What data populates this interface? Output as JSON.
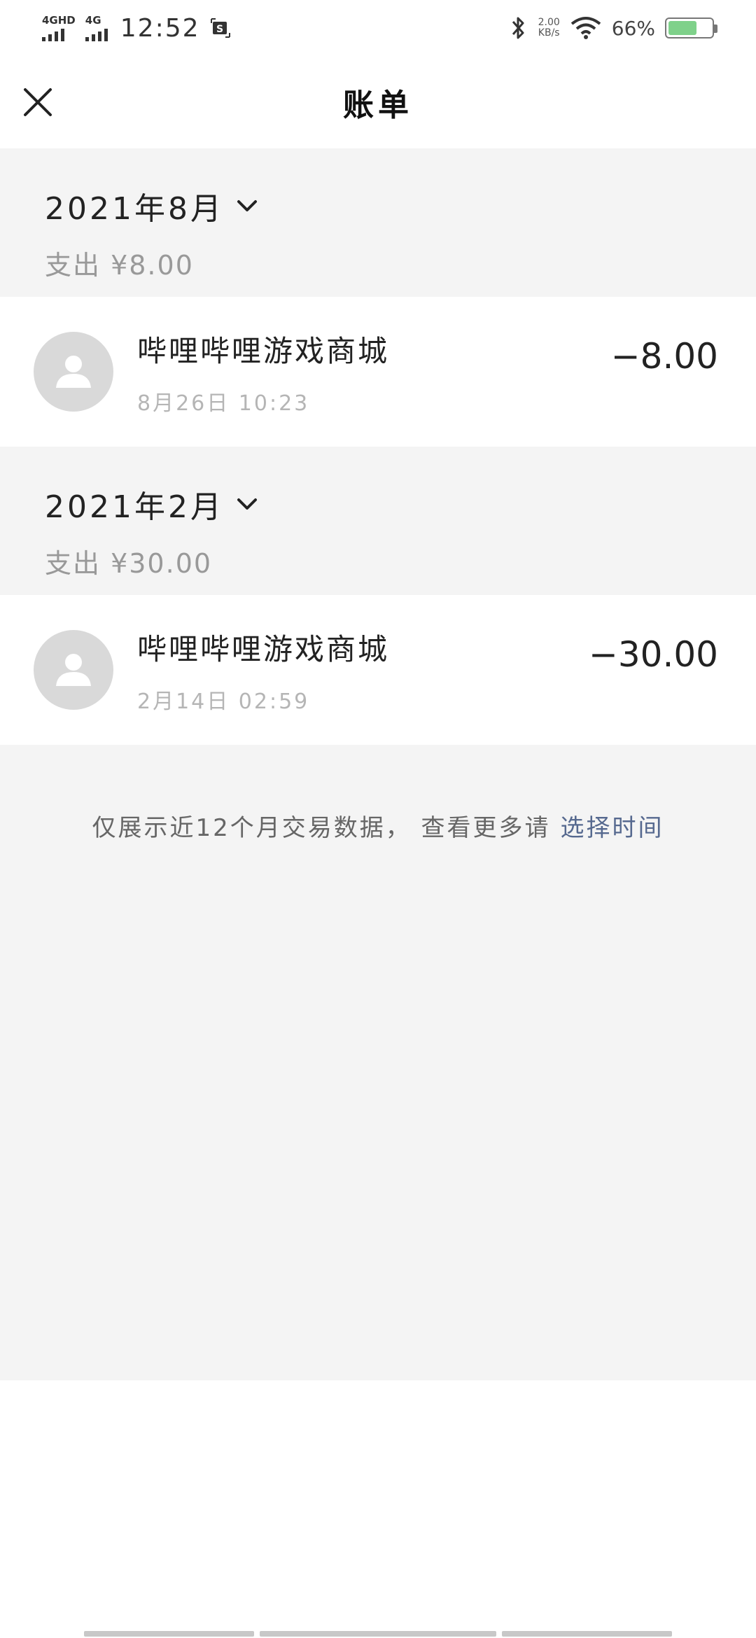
{
  "status_bar": {
    "network1": "4GHD",
    "network2": "4G",
    "time": "12:52",
    "speed_value": "2.00",
    "speed_unit": "KB/s",
    "battery_percent": "66%",
    "battery_level": 0.66
  },
  "header": {
    "title": "账单"
  },
  "months": [
    {
      "label": "2021年8月",
      "total": "支出 ¥8.00",
      "transactions": [
        {
          "merchant": "哔哩哔哩游戏商城",
          "time": "8月26日 10:23",
          "amount": "−8.00"
        }
      ]
    },
    {
      "label": "2021年2月",
      "total": "支出 ¥30.00",
      "transactions": [
        {
          "merchant": "哔哩哔哩游戏商城",
          "time": "2月14日 02:59",
          "amount": "−30.00"
        }
      ]
    }
  ],
  "footer": {
    "note": "仅展示近12个月交易数据， 查看更多请",
    "link": "选择时间"
  },
  "colors": {
    "background_gray": "#f4f4f4",
    "link_blue": "#56698f",
    "avatar_gray": "#d9d9d9",
    "secondary_text": "#999999"
  }
}
